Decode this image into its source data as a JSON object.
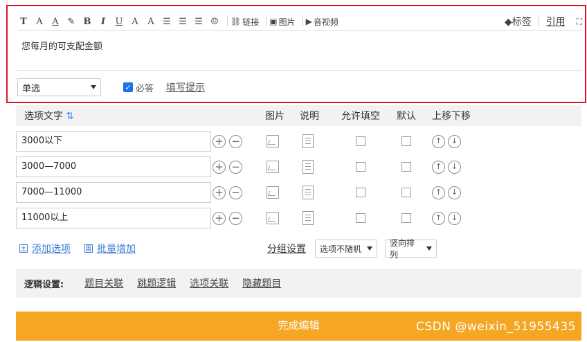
{
  "toolbar": {
    "link_label": "链接",
    "image_label": "图片",
    "av_label": "音视频",
    "tag_label": "标签",
    "quote_label": "引用"
  },
  "editor": {
    "content": "您每月的可支配金额"
  },
  "question_settings": {
    "type_value": "单选",
    "required_label": "必答",
    "hint_link": "填写提示"
  },
  "options_table": {
    "headers": {
      "option_text": "选项文字",
      "image": "图片",
      "description": "说明",
      "allow_fill": "允许填空",
      "default": "默认",
      "move": "上移下移"
    },
    "rows": [
      {
        "text": "3000以下"
      },
      {
        "text": "3000—7000"
      },
      {
        "text": "7000—11000"
      },
      {
        "text": "11000以上"
      }
    ]
  },
  "add_actions": {
    "add_option": "添加选项",
    "bulk_add": "批量增加",
    "group_settings": "分组设置",
    "random_value": "选项不随机",
    "layout_value": "竖向排列"
  },
  "logic": {
    "title": "逻辑设置:",
    "links": [
      "题目关联",
      "跳题逻辑",
      "选项关联",
      "隐藏题目"
    ]
  },
  "footer": {
    "done_label": "完成编辑",
    "watermark": "CSDN @weixin_51955435"
  },
  "colors": {
    "highlight": "#e0141e",
    "accent": "#3a7bd5",
    "done_button": "#f5a623"
  }
}
